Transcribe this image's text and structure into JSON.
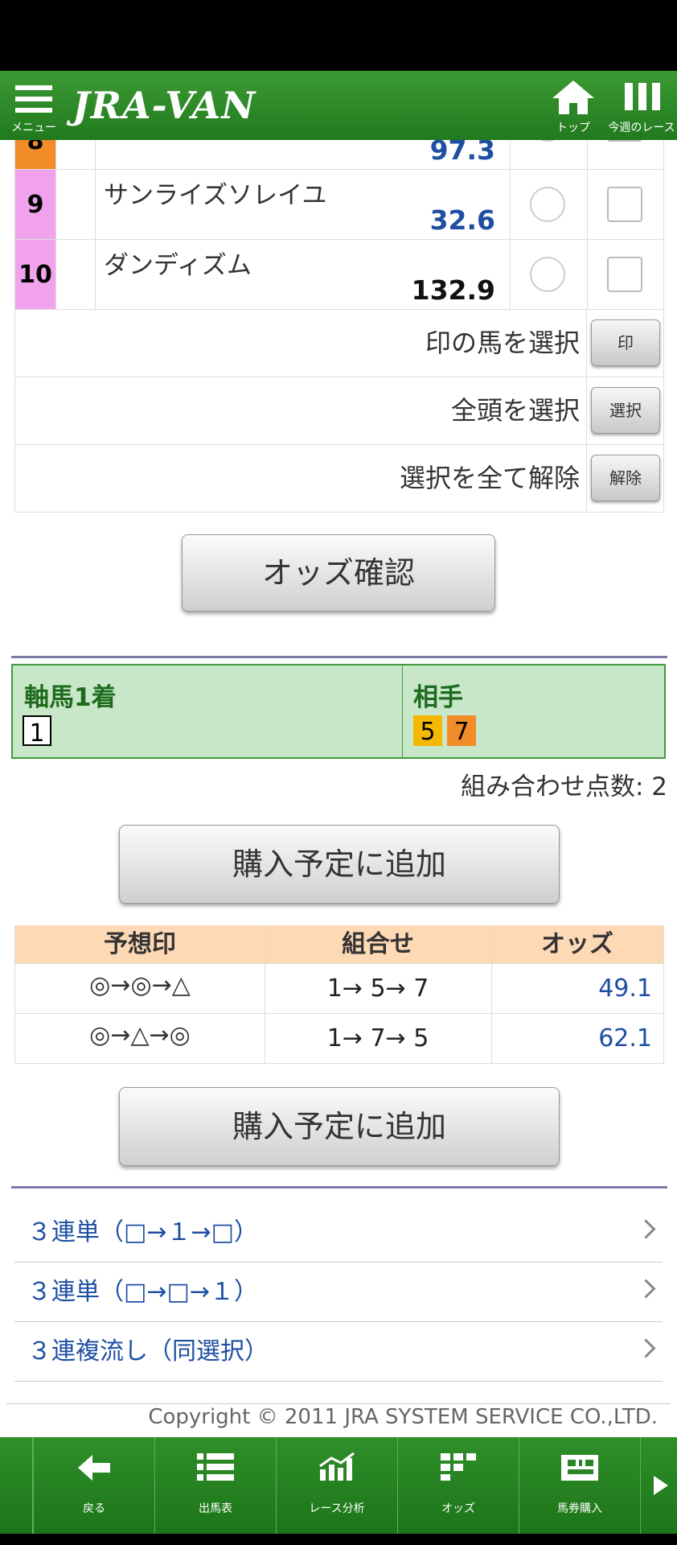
{
  "header": {
    "menu_label": "メニュー",
    "logo": "JRA-VAN",
    "top_label": "トップ",
    "week_label": "今週のレース"
  },
  "horses": [
    {
      "waku_no": "8",
      "odds": "97.3",
      "odds_color": "#1e4fa3",
      "waku_color": "#f28c28"
    },
    {
      "waku_no": "9",
      "name": "サンライズソレイユ",
      "odds": "32.6",
      "odds_color": "#1e4fa3",
      "waku_color": "#f0a3ec"
    },
    {
      "waku_no": "10",
      "name": "ダンディズム",
      "odds": "132.9",
      "odds_color": "#111111",
      "waku_color": "#f0a3ec"
    }
  ],
  "select_rows": [
    {
      "label": "印の馬を選択",
      "button": "印"
    },
    {
      "label": "全頭を選択",
      "button": "選択"
    },
    {
      "label": "選択を全て解除",
      "button": "解除"
    }
  ],
  "odds_check_button": "オッズ確認",
  "axis": {
    "left_title": "軸馬1着",
    "left_numbers": [
      "1"
    ],
    "right_title": "相手",
    "right_numbers": [
      {
        "n": "5",
        "color": "#f5b800"
      },
      {
        "n": "7",
        "color": "#f28c28"
      }
    ]
  },
  "combo_count_label": "組み合わせ点数: 2",
  "add_button": "購入予定に追加",
  "prediction_table": {
    "headers": [
      "予想印",
      "組合せ",
      "オッズ"
    ],
    "rows": [
      {
        "marks": "◎→◎→△",
        "combo": "1→ 5→ 7",
        "odds": "49.1"
      },
      {
        "marks": "◎→△→◎",
        "combo": "1→ 7→ 5",
        "odds": "62.1"
      }
    ]
  },
  "add_button_2": "購入予定に追加",
  "links": [
    "３連単（□→１→□）",
    "３連単（□→□→１）",
    "３連複流し（同選択）"
  ],
  "copyright": "Copyright © 2011 JRA SYSTEM SERVICE CO.,LTD.",
  "footer": [
    "戻る",
    "出馬表",
    "レース分析",
    "オッズ",
    "馬券購入"
  ],
  "colors": {
    "brand_green": "#2e8b2a",
    "link_blue": "#1e4fa3"
  }
}
